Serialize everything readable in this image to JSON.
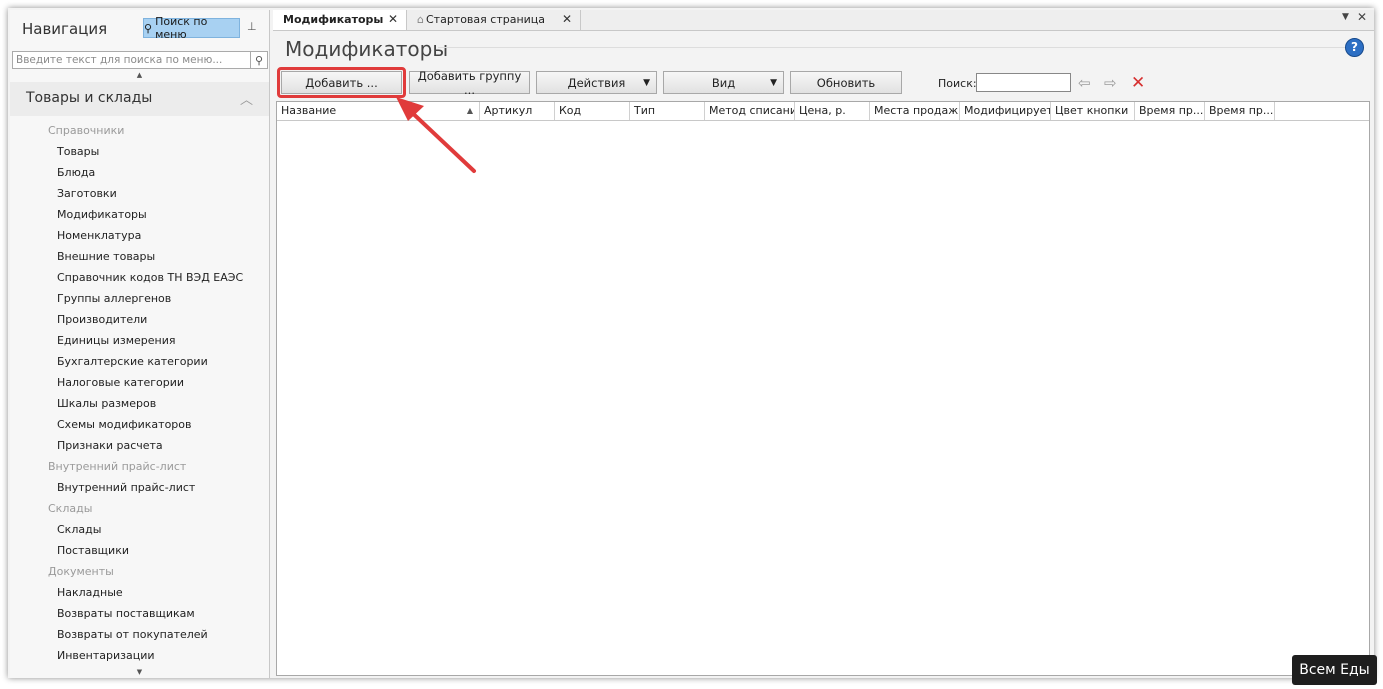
{
  "colors": {
    "accent": "#a8d1f2",
    "highlight": "#e03b3b",
    "help": "#2d6fc4",
    "clear": "#d62f2f"
  },
  "nav": {
    "title": "Навигация",
    "search_menu_button": "Поиск по меню",
    "search_placeholder": "Введите текст для поиска по меню...",
    "section": "Товары и склады",
    "items": [
      {
        "type": "group",
        "label": "Справочники"
      },
      {
        "type": "item",
        "label": "Товары"
      },
      {
        "type": "item",
        "label": "Блюда"
      },
      {
        "type": "item",
        "label": "Заготовки"
      },
      {
        "type": "item",
        "label": "Модификаторы"
      },
      {
        "type": "item",
        "label": "Номенклатура"
      },
      {
        "type": "item",
        "label": "Внешние товары"
      },
      {
        "type": "item",
        "label": "Справочник кодов ТН ВЭД ЕАЭС"
      },
      {
        "type": "item",
        "label": "Группы аллергенов"
      },
      {
        "type": "item",
        "label": "Производители"
      },
      {
        "type": "item",
        "label": "Единицы измерения"
      },
      {
        "type": "item",
        "label": "Бухгалтерские категории"
      },
      {
        "type": "item",
        "label": "Налоговые категории"
      },
      {
        "type": "item",
        "label": "Шкалы размеров"
      },
      {
        "type": "item",
        "label": "Схемы модификаторов"
      },
      {
        "type": "item",
        "label": "Признаки расчета"
      },
      {
        "type": "group",
        "label": "Внутренний прайс-лист"
      },
      {
        "type": "item",
        "label": "Внутренний прайс-лист"
      },
      {
        "type": "group",
        "label": "Склады"
      },
      {
        "type": "item",
        "label": "Склады"
      },
      {
        "type": "item",
        "label": "Поставщики"
      },
      {
        "type": "group",
        "label": "Документы"
      },
      {
        "type": "item",
        "label": "Накладные"
      },
      {
        "type": "item",
        "label": "Возвраты поставщикам"
      },
      {
        "type": "item",
        "label": "Возвраты от покупателей"
      },
      {
        "type": "item",
        "label": "Инвентаризации"
      }
    ]
  },
  "tabs": [
    {
      "label": "Модификаторы",
      "active": true
    },
    {
      "label": "Стартовая страница",
      "active": false
    }
  ],
  "main": {
    "title": "Модификаторы",
    "toolbar": {
      "add": "Добавить ...",
      "add_group": "Добавить группу ...",
      "actions": "Действия",
      "view": "Вид",
      "refresh": "Обновить",
      "search_label": "Поиск:",
      "search_value": ""
    },
    "columns": [
      "Название",
      "Артикул",
      "Код",
      "Тип",
      "Метод списания",
      "Цена, р.",
      "Места продаж",
      "Модифицирует",
      "Цвет кнопки",
      "Время пр...",
      "Время пр..."
    ]
  },
  "watermark": "Всем Еды"
}
